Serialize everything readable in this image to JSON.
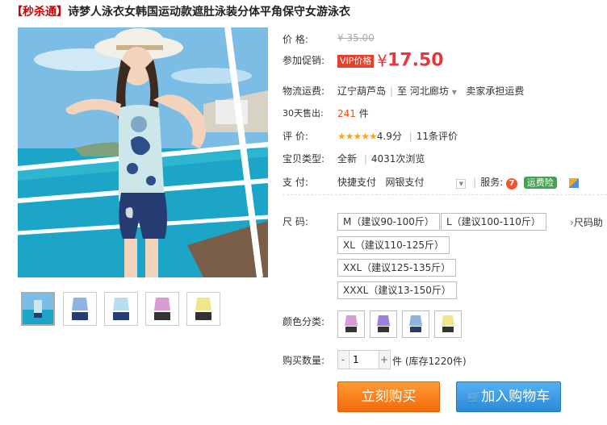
{
  "title": {
    "promo": "【秒杀通】",
    "text": "诗梦人泳衣女韩国运动款遮肚泳装分体平角保守女游泳衣"
  },
  "price": {
    "label": "价      格:",
    "original": "¥ 35.00"
  },
  "promo": {
    "label": "参加促销:",
    "vip": "VIP价格",
    "currency": "¥",
    "value": "17.50"
  },
  "shipping": {
    "label": "物流运费:",
    "from": "辽宁葫芦岛",
    "to_prefix": "至",
    "to": "河北廊坊",
    "note": "卖家承担运费"
  },
  "sales": {
    "label": "30天售出:",
    "count": "241",
    "unit": "件"
  },
  "rating": {
    "label": "评      价:",
    "stars": "★★★★★",
    "score": "4.9分",
    "reviews": "11条评价"
  },
  "type": {
    "label": "宝贝类型:",
    "condition": "全新",
    "views": "4031次浏览"
  },
  "payment": {
    "label": "支      付:",
    "quick": "快捷支付",
    "bank": "网银支付",
    "service_label": "服务:",
    "service_badge": "运费险"
  },
  "size": {
    "label": "尺      码:",
    "options": [
      "M（建议90-100斤）",
      "L（建议100-110斤）",
      "XL（建议110-125斤）",
      "XXL（建议125-135斤）",
      "XXXL（建议13-150斤）"
    ],
    "chart_link": "尺码助"
  },
  "color": {
    "label": "颜色分类:"
  },
  "quantity": {
    "label": "购买数量:",
    "value": "1",
    "stock": "件 (库存1220件)"
  },
  "actions": {
    "buy": "立刻购买",
    "cart": "加入购物车"
  },
  "colors": {
    "accent": "#e4393c",
    "buy": "#f26b0a",
    "cart": "#2a8ad8"
  }
}
